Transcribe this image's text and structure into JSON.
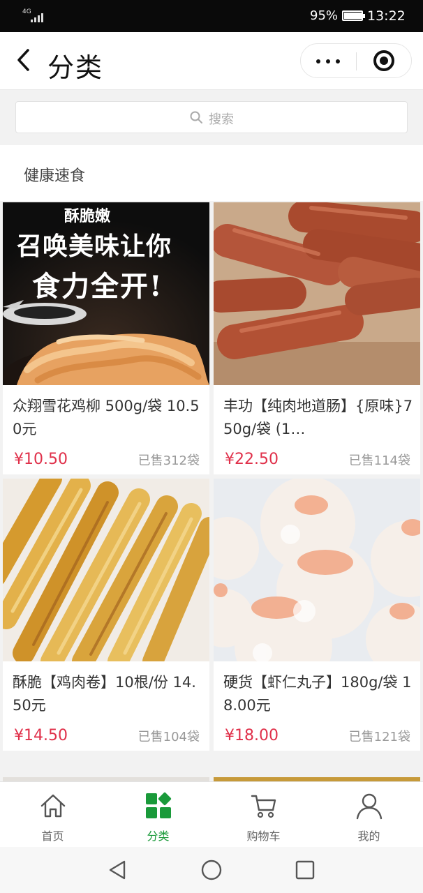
{
  "status_bar": {
    "network": "4G",
    "battery_percent": "95%",
    "battery_level": 0.95,
    "time": "13:22"
  },
  "nav": {
    "title": "分类",
    "back_icon": "chevron-left-icon",
    "more_icon": "more-dots-icon",
    "close_icon": "target-circle-icon"
  },
  "search": {
    "placeholder": "搜索",
    "icon": "search-icon"
  },
  "category": {
    "name": "健康速食"
  },
  "products": [
    {
      "name": "众翔雪花鸡柳 500g/袋 10.50元",
      "price": "¥10.50",
      "sold": "已售312袋",
      "image_text_1": "酥脆嫩",
      "image_text_2": "召唤美味让你",
      "image_text_3": "食力全开!"
    },
    {
      "name": "丰功【纯肉地道肠】{原味}750g/袋 (1…",
      "price": "¥22.50",
      "sold": "已售114袋"
    },
    {
      "name": "酥脆【鸡肉卷】10根/份 14.50元",
      "price": "¥14.50",
      "sold": "已售104袋"
    },
    {
      "name": "硬货【虾仁丸子】180g/袋 18.00元",
      "price": "¥18.00",
      "sold": "已售121袋"
    }
  ],
  "tabbar": {
    "items": [
      {
        "label": "首页",
        "icon": "home-icon"
      },
      {
        "label": "分类",
        "icon": "category-grid-icon",
        "active": true
      },
      {
        "label": "购物车",
        "icon": "cart-icon"
      },
      {
        "label": "我的",
        "icon": "user-icon"
      }
    ]
  },
  "system_nav": {
    "back_icon": "triangle-back-icon",
    "home_icon": "circle-home-icon",
    "recents_icon": "square-recents-icon"
  },
  "colors": {
    "accent_green": "#1a9a3a",
    "price_red": "#e0304a",
    "background": "#f2f2f2"
  }
}
